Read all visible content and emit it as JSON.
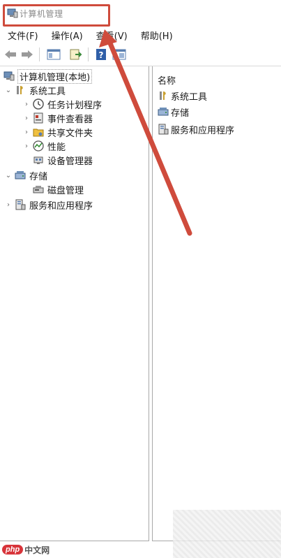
{
  "window": {
    "title": "计算机管理"
  },
  "menu": [
    {
      "label": "文件(F)"
    },
    {
      "label": "操作(A)"
    },
    {
      "label": "查看(V)"
    },
    {
      "label": "帮助(H)"
    }
  ],
  "tree": {
    "root": "计算机管理(本地)",
    "system_tools": "系统工具",
    "task_scheduler": "任务计划程序",
    "event_viewer": "事件查看器",
    "shared_folders": "共享文件夹",
    "performance": "性能",
    "device_manager": "设备管理器",
    "storage": "存储",
    "disk_management": "磁盘管理",
    "services_apps": "服务和应用程序"
  },
  "list": {
    "header": "名称",
    "items": [
      {
        "label": "系统工具"
      },
      {
        "label": "存储"
      },
      {
        "label": "服务和应用程序"
      }
    ]
  },
  "watermark": {
    "logo": "php",
    "text": "中文网"
  },
  "colors": {
    "annotation": "#cf4b3c",
    "watermark_red": "#d8343a"
  }
}
